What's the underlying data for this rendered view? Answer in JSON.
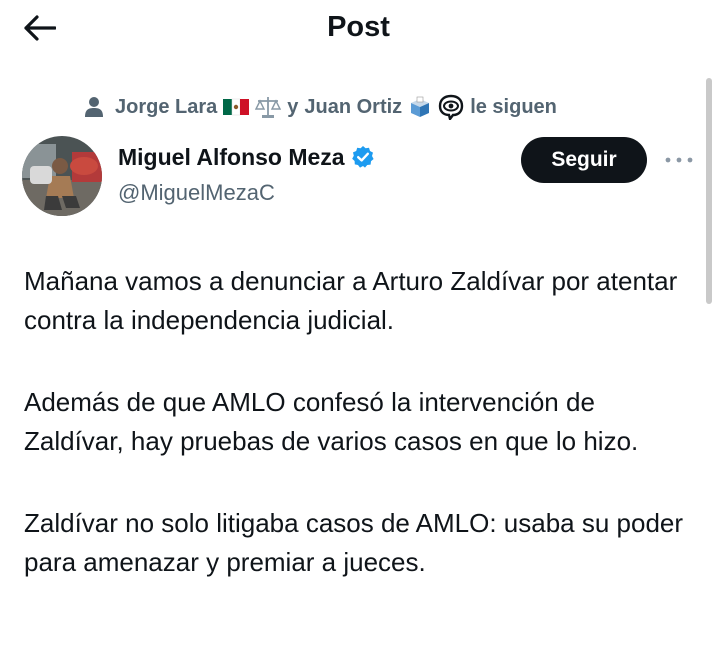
{
  "header": {
    "title": "Post",
    "back_icon": "arrow-left-icon"
  },
  "social_context": {
    "icon": "person-icon",
    "follower_1": "Jorge Lara",
    "follower_1_emojis": [
      "mexico-flag-emoji",
      "balance-scale-emoji"
    ],
    "connector": "y",
    "follower_2": "Juan Ortiz",
    "follower_2_emojis": [
      "ballot-box-emoji",
      "eye-in-speech-bubble-emoji"
    ],
    "suffix": "le siguen"
  },
  "author": {
    "display_name": "Miguel Alfonso Meza",
    "handle": "@MiguelMezaC",
    "verified": true,
    "verified_color": "#1d9bf0"
  },
  "actions": {
    "follow_label": "Seguir",
    "more_icon": "more-horizontal-icon"
  },
  "post": {
    "paragraphs": [
      "Mañana vamos a denunciar a Arturo Zaldívar por atentar contra la independencia judicial.",
      "Además de que AMLO confesó la intervención de Zaldívar, hay pruebas de varios casos en que lo hizo.",
      "Zaldívar no solo litigaba casos de AMLO: usaba su poder para amenazar y premiar a jueces."
    ]
  },
  "colors": {
    "text_primary": "#0f1419",
    "text_secondary": "#536471",
    "follow_button_bg": "#0f1419",
    "follow_button_text": "#ffffff"
  }
}
